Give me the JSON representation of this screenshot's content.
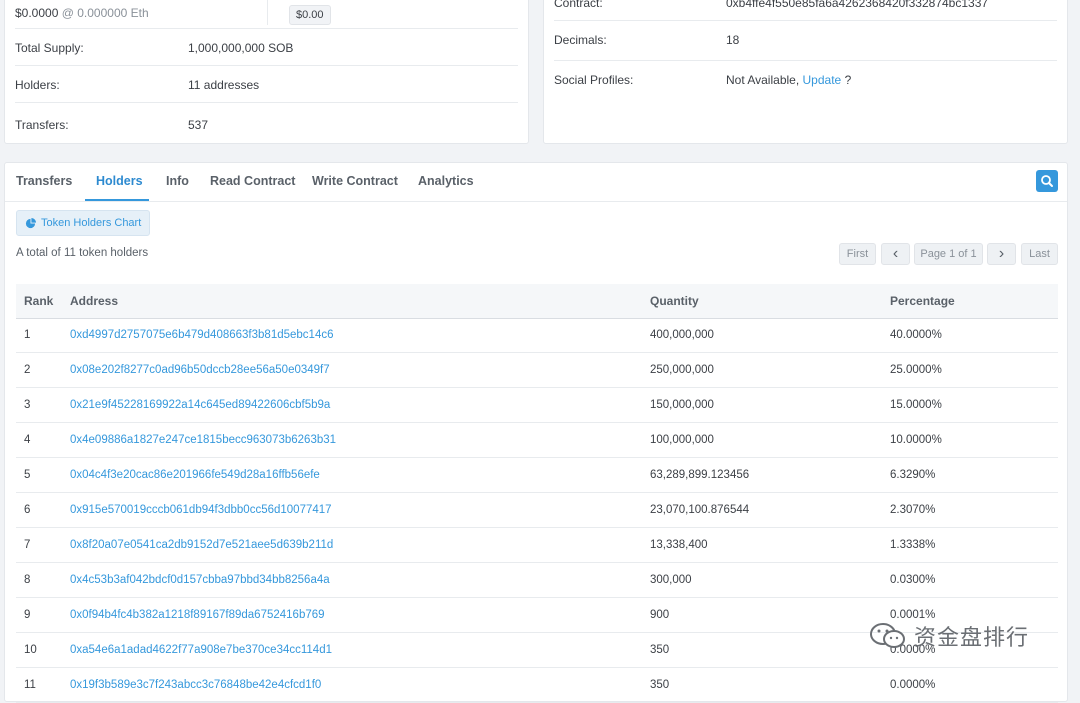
{
  "overview": {
    "price_value": "$0.0000",
    "price_eth": "@ 0.000000 Eth",
    "market_cap_button": "$0.00",
    "total_supply_label": "Total Supply:",
    "total_supply_value": "1,000,000,000 SOB",
    "holders_label": "Holders:",
    "holders_value": "11 addresses",
    "transfers_label": "Transfers:",
    "transfers_value": "537"
  },
  "profile": {
    "contract_label": "Contract:",
    "contract_value": "0xb4ffe4f550e85fa6a4262368420f332874bc1337",
    "decimals_label": "Decimals:",
    "decimals_value": "18",
    "social_label": "Social Profiles:",
    "social_value": "Not Available,",
    "social_update": "Update",
    "social_help": "?"
  },
  "tabs": [
    {
      "label": "Transfers"
    },
    {
      "label": "Holders"
    },
    {
      "label": "Info"
    },
    {
      "label": "Read Contract"
    },
    {
      "label": "Write Contract"
    },
    {
      "label": "Analytics"
    }
  ],
  "active_tab": "Holders",
  "holders": {
    "chart_button": "Token Holders Chart",
    "total_text": "A total of 11 token holders",
    "pager": {
      "first": "First",
      "prev": "‹",
      "page": "Page 1 of 1",
      "next": "›",
      "last": "Last"
    },
    "columns": [
      "Rank",
      "Address",
      "Quantity",
      "Percentage"
    ],
    "rows": [
      {
        "rank": "1",
        "address": "0xd4997d2757075e6b479d408663f3b81d5ebc14c6",
        "quantity": "400,000,000",
        "percentage": "40.0000%"
      },
      {
        "rank": "2",
        "address": "0x08e202f8277c0ad96b50dccb28ee56a50e0349f7",
        "quantity": "250,000,000",
        "percentage": "25.0000%"
      },
      {
        "rank": "3",
        "address": "0x21e9f45228169922a14c645ed89422606cbf5b9a",
        "quantity": "150,000,000",
        "percentage": "15.0000%"
      },
      {
        "rank": "4",
        "address": "0x4e09886a1827e247ce1815becc963073b6263b31",
        "quantity": "100,000,000",
        "percentage": "10.0000%"
      },
      {
        "rank": "5",
        "address": "0x04c4f3e20cac86e201966fe549d28a16ffb56efe",
        "quantity": "63,289,899.123456",
        "percentage": "6.3290%"
      },
      {
        "rank": "6",
        "address": "0x915e570019cccb061db94f3dbb0cc56d10077417",
        "quantity": "23,070,100.876544",
        "percentage": "2.3070%"
      },
      {
        "rank": "7",
        "address": "0x8f20a07e0541ca2db9152d7e521aee5d639b211d",
        "quantity": "13,338,400",
        "percentage": "1.3338%"
      },
      {
        "rank": "8",
        "address": "0x4c53b3af042bdcf0d157cbba97bbd34bb8256a4a",
        "quantity": "300,000",
        "percentage": "0.0300%"
      },
      {
        "rank": "9",
        "address": "0x0f94b4fc4b382a1218f89167f89da6752416b769",
        "quantity": "900",
        "percentage": "0.0001%"
      },
      {
        "rank": "10",
        "address": "0xa54e6a1adad4622f77a908e7be370ce34cc114d1",
        "quantity": "350",
        "percentage": "0.0000%"
      },
      {
        "rank": "11",
        "address": "0x19f3b589e3c7f243abcc3c76848be42e4cfcd1f0",
        "quantity": "350",
        "percentage": "0.0000%"
      }
    ]
  },
  "watermark": "资金盘排行",
  "colors": {
    "accent": "#3598dc",
    "background": "#f1f3f6"
  }
}
